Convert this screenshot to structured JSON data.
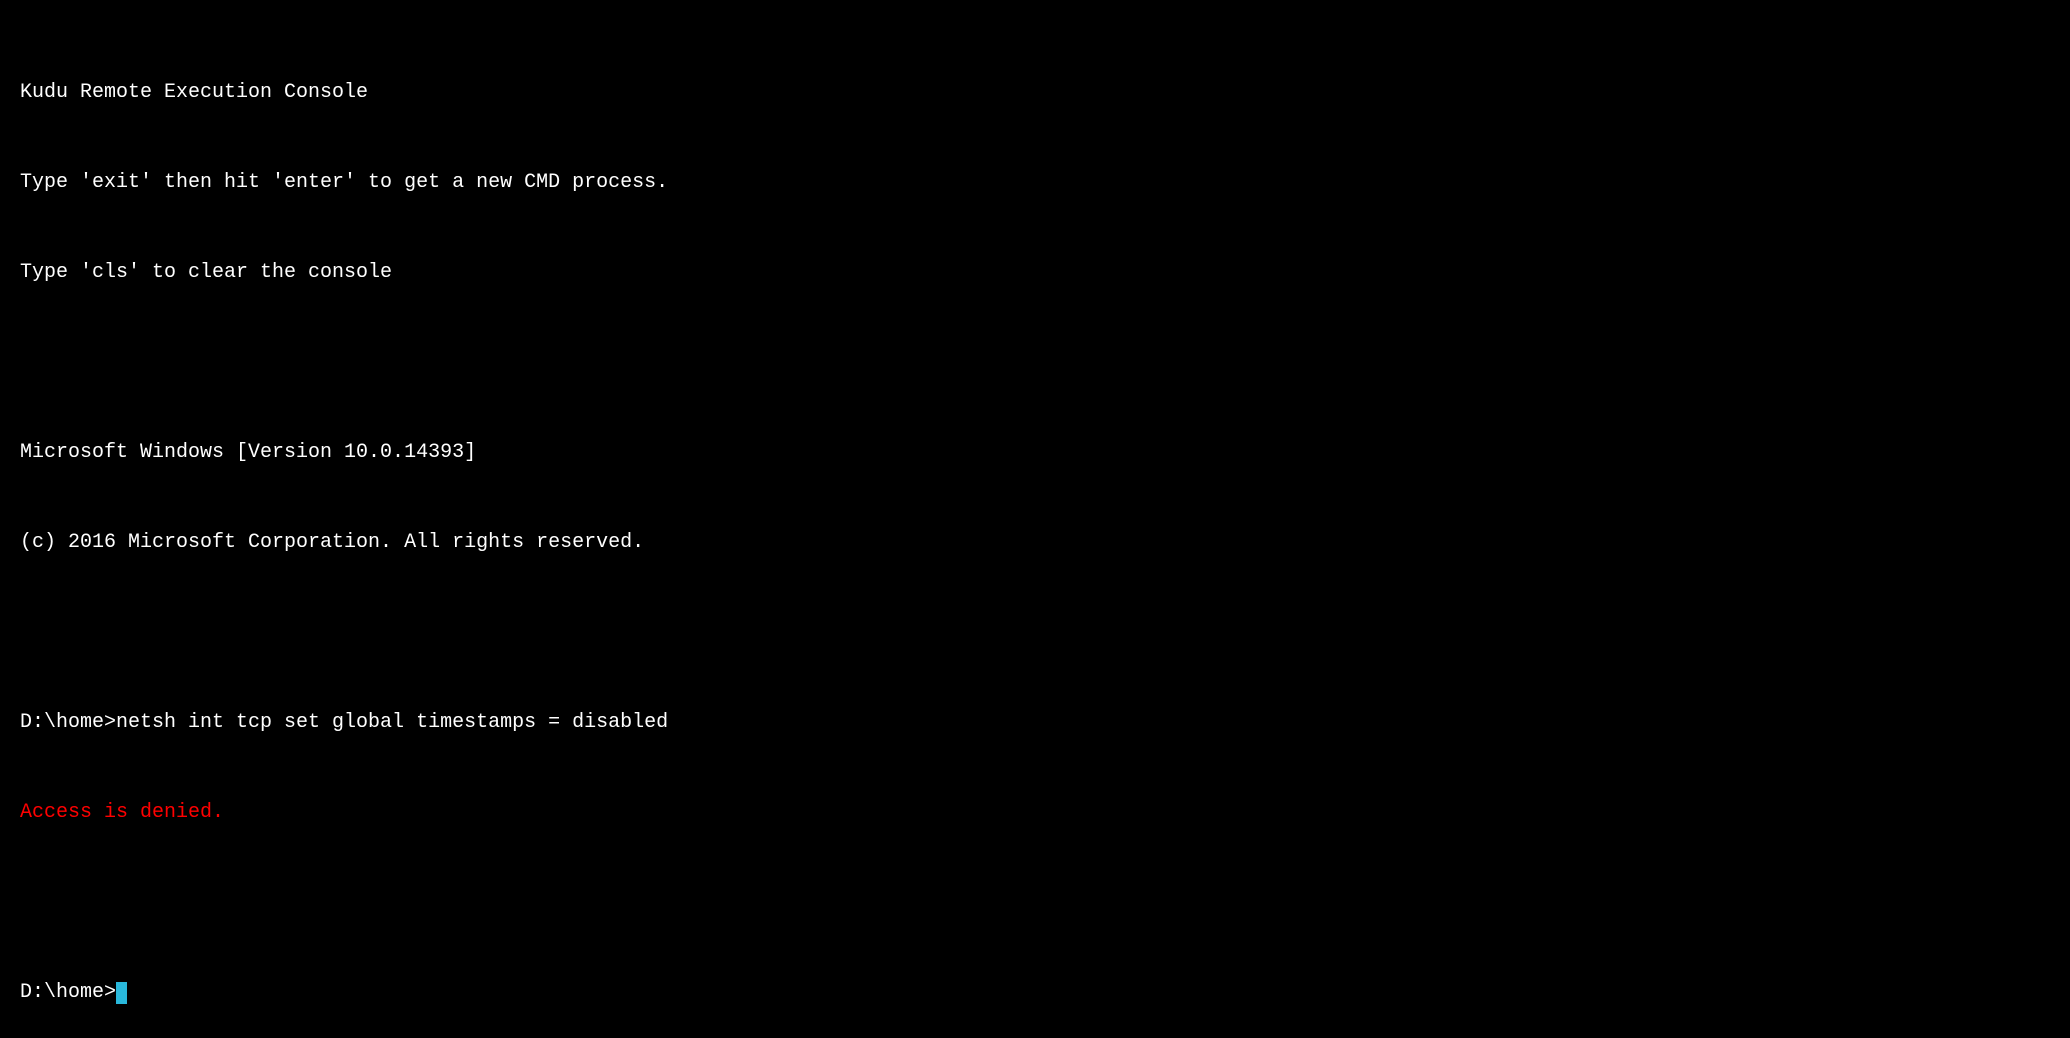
{
  "header": {
    "title": "Kudu Remote Execution Console",
    "hint1": "Type 'exit' then hit 'enter' to get a new CMD process.",
    "hint2": "Type 'cls' to clear the console"
  },
  "os": {
    "version_line": "Microsoft Windows [Version 10.0.14393]",
    "copyright": "(c) 2016 Microsoft Corporation. All rights reserved."
  },
  "history": {
    "prompt1": "D:\\home>",
    "command1": "netsh int tcp set global timestamps = disabled",
    "error1": "Access is denied."
  },
  "current": {
    "prompt": "D:\\home>"
  },
  "colors": {
    "bg": "#000000",
    "fg": "#ffffff",
    "error": "#ff0000",
    "cursor": "#29b8db"
  }
}
